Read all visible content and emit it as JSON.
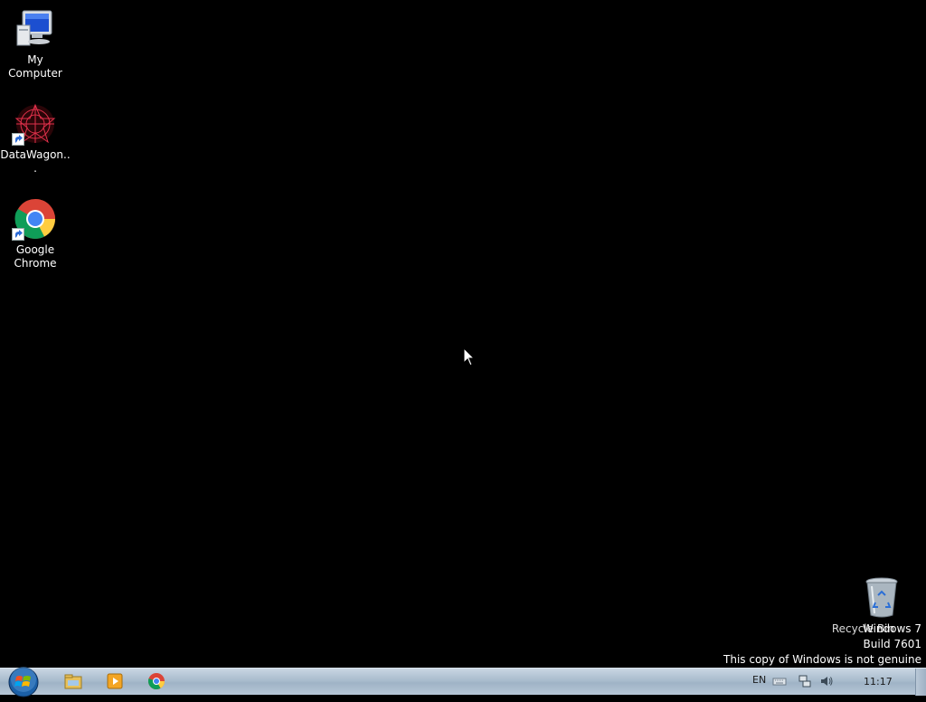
{
  "desktop": {
    "icons": [
      {
        "label": "My Computer",
        "icon": "computer-icon"
      },
      {
        "label": "DataWagon...",
        "icon": "datawagon-icon"
      },
      {
        "label": "Google Chrome",
        "icon": "chrome-icon"
      },
      {
        "label": "Recycle Bin",
        "icon": "recycle-bin-icon"
      }
    ]
  },
  "watermark": {
    "line1": "Windows 7",
    "line2": "Build 7601",
    "line3": "This copy of Windows is not genuine"
  },
  "taskbar": {
    "pinned": [
      "explorer-icon",
      "media-player-icon",
      "chrome-icon"
    ],
    "tray": {
      "language": "EN",
      "clock": "11:17"
    }
  }
}
